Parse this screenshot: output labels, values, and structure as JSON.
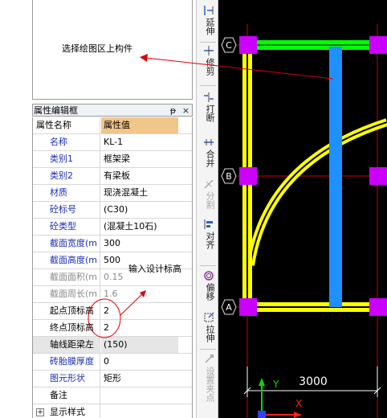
{
  "preview": {
    "hint": "选择绘图区上构件"
  },
  "panel": {
    "title": "属性编辑框",
    "pin_label": "ᵽ",
    "close_label": "×",
    "col_name": "属性名称",
    "col_value": "属性值"
  },
  "props": [
    {
      "name": "名称",
      "value": "KL-1"
    },
    {
      "name": "类别1",
      "value": "框架梁"
    },
    {
      "name": "类别2",
      "value": "有梁板"
    },
    {
      "name": "材质",
      "value": "现浇混凝土"
    },
    {
      "name": "砼标号",
      "value": "(C30)"
    },
    {
      "name": "砼类型",
      "value": "(混凝土10石)"
    },
    {
      "name": "截面宽度(m",
      "value": "300"
    },
    {
      "name": "截面高度(m",
      "value": "500"
    },
    {
      "name": "截面面积(m",
      "value": "0.15"
    },
    {
      "name": "截面周长(m",
      "value": "1.6"
    },
    {
      "name": "起点顶标高",
      "value": "2"
    },
    {
      "name": "终点顶标高",
      "value": "2"
    },
    {
      "name": "轴线距梁左",
      "value": "(150)"
    },
    {
      "name": "砖胎膜厚度",
      "value": "0"
    },
    {
      "name": "图元形状",
      "value": "矩形"
    },
    {
      "name": "备注",
      "value": ""
    },
    {
      "name": "显示样式",
      "value": ""
    }
  ],
  "annotation": {
    "text": "输入设计标高"
  },
  "toolbar": {
    "tools": [
      {
        "label": "延伸",
        "icon": "extend-icon"
      },
      {
        "label": "修剪",
        "icon": "trim-icon"
      },
      {
        "label": "打断",
        "icon": "break-icon"
      },
      {
        "label": "合并",
        "icon": "merge-icon"
      },
      {
        "label": "分割",
        "icon": "split-icon"
      },
      {
        "label": "对齐",
        "icon": "align-icon"
      },
      {
        "label": "偏移",
        "icon": "offset-icon"
      },
      {
        "label": "拉伸",
        "icon": "stretch-icon"
      },
      {
        "label": "设置夹点",
        "icon": "grip-icon"
      }
    ]
  },
  "canvas": {
    "axis_c": "C",
    "axis_b": "B",
    "axis_a": "A",
    "dimension": "3000",
    "ucs_y": "Y",
    "ucs_x": "X"
  },
  "colors": {
    "canvas_bg": "#000000",
    "beam_yellow": "#ffff00",
    "beam_green": "#00ff00",
    "beam_blue": "#1e90ff",
    "column_magenta": "#cc00ff",
    "axis_red": "#ff0000",
    "annot_red": "#e00000",
    "header_orange": "#f1c68a",
    "label_blue": "#1a2fb8"
  }
}
